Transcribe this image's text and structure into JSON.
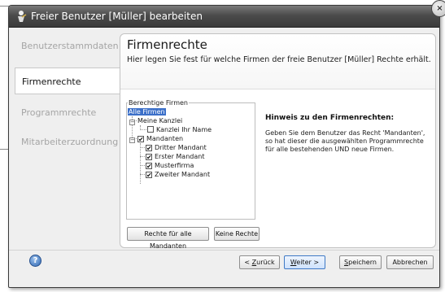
{
  "window": {
    "title": "Freier Benutzer [Müller] bearbeiten",
    "close_glyph": "×"
  },
  "nav": {
    "items": [
      {
        "label": "Benutzerstammdaten",
        "active": false
      },
      {
        "label": "Firmenrechte",
        "active": true
      },
      {
        "label": "Programmrechte",
        "active": false
      },
      {
        "label": "Mitarbeiterzuordnung",
        "active": false
      }
    ]
  },
  "header": {
    "title": "Firmenrechte",
    "subtitle": "Hier legen Sie fest für welche Firmen der freie Benutzer [Müller] Rechte erhält."
  },
  "tree": {
    "group_label": "Berechtige Firmen",
    "root": "Alle Firmen",
    "kanzlei": "Meine Kanzlei",
    "kanzlei_child": "Kanzlei Ihr Name",
    "mandanten": "Mandanten",
    "mandanten_children": [
      "Dritter Mandant",
      "Erster Mandant",
      "Musterfirma",
      "Zweiter Mandant"
    ],
    "expander_collapsed": "−",
    "check_glyph": "✔"
  },
  "hint": {
    "title": "Hinweis zu den Firmenrechten:",
    "text": "Geben Sie dem Benutzer das Recht 'Mandanten', so hat dieser die ausgewählten Programmrechte für alle bestehenden UND neue Firmen."
  },
  "buttons": {
    "all_rights": "Rechte für alle Mandanten",
    "no_rights": "Keine Rechte",
    "back_prefix": "< ",
    "back_key": "Z",
    "back_rest": "urück",
    "next_key": "W",
    "next_rest": "eiter >",
    "save_key": "S",
    "save_rest": "peichern",
    "cancel": "Abbrechen",
    "help_glyph": "?"
  },
  "colors": {
    "selection": "#3b6fc8",
    "titlebar": "#4b4b4b"
  }
}
